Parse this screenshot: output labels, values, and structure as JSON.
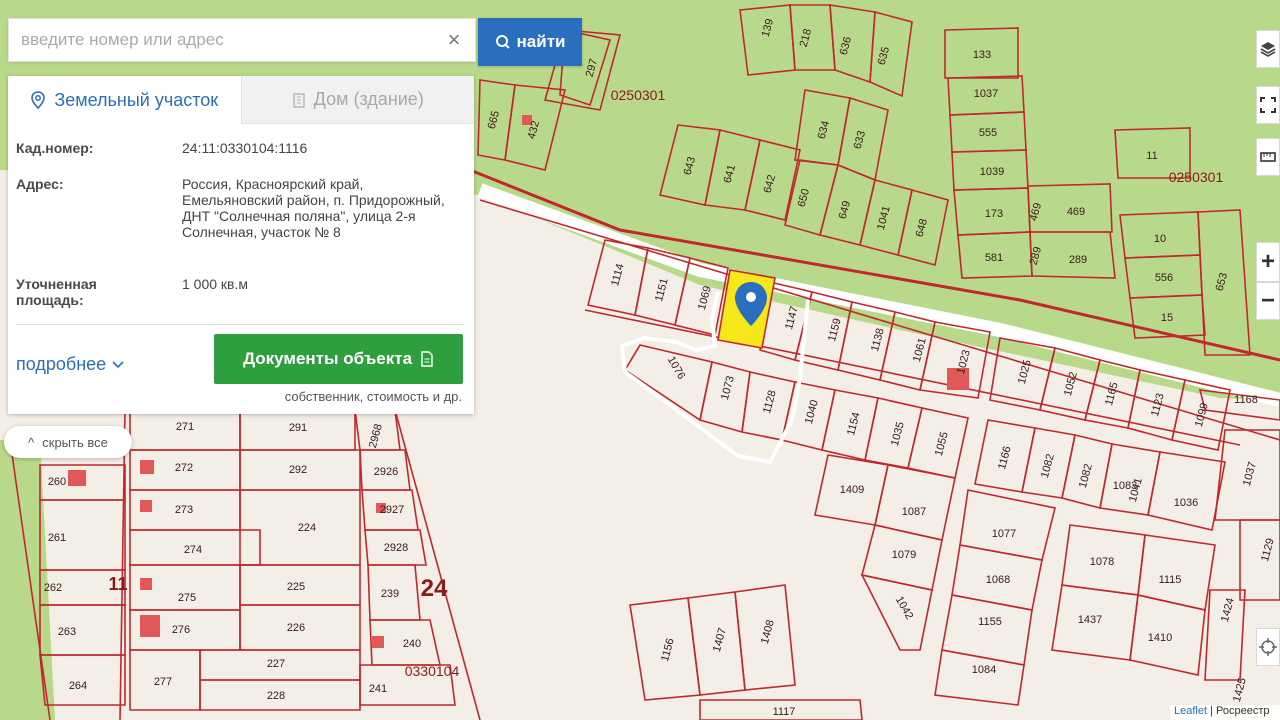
{
  "search": {
    "placeholder": "введите номер или адрес",
    "button_label": "найти"
  },
  "panel": {
    "tabs": [
      {
        "label": "Земельный участок"
      },
      {
        "label": "Дом (здание)"
      }
    ],
    "fields": [
      {
        "key": "Кад.номер:",
        "value": "24:11:0330104:1116"
      },
      {
        "key": "Адрес:",
        "value": "Россия, Красноярский край, Емельяновский район, п. Придорожный, ДНТ \"Солнечная поляна\", улица 2-я Солнечная, участок № 8"
      },
      {
        "key": "Уточненная площадь:",
        "value": "1 000 кв.м"
      }
    ],
    "more_label": "подробнее",
    "docs_button_label": "Документы объекта",
    "docs_note": "собственник, стоимость и др."
  },
  "hide_all_label": "скрыть все",
  "map": {
    "quarter_labels": [
      "0250301",
      "0250301",
      "0330104"
    ],
    "big_labels": [
      "24",
      "11"
    ],
    "parcels": [
      "139",
      "218",
      "636",
      "635",
      "133",
      "1037",
      "555",
      "1039",
      "173",
      "469",
      "469",
      "581",
      "289",
      "289",
      "297",
      "665",
      "432",
      "643",
      "641",
      "642",
      "634",
      "633",
      "650",
      "649",
      "1041",
      "648",
      "11",
      "10",
      "556",
      "15",
      "653",
      "1114",
      "1151",
      "1069",
      "1147",
      "1159",
      "1138",
      "1061",
      "1023",
      "1025",
      "1052",
      "1165",
      "1123",
      "1099",
      "1168",
      "1076",
      "1073",
      "1128",
      "1040",
      "1154",
      "1035",
      "1055",
      "1166",
      "1082",
      "1082",
      "1083",
      "1041",
      "1036",
      "1037",
      "1409",
      "1087",
      "1079",
      "1042",
      "1077",
      "1068",
      "1155",
      "1084",
      "1078",
      "1115",
      "1437",
      "1410",
      "1129",
      "1424",
      "1156",
      "1407",
      "1408",
      "1117",
      "271",
      "291",
      "2968",
      "272",
      "292",
      "2926",
      "260",
      "273",
      "2927",
      "261",
      "224",
      "274",
      "2928",
      "262",
      "275",
      "225",
      "239",
      "263",
      "276",
      "226",
      "240",
      "227",
      "264",
      "277",
      "228",
      "241",
      "1425"
    ],
    "zoom_in_label": "+",
    "zoom_out_label": "−"
  },
  "attribution": {
    "leaflet": "Leaflet",
    "rest": "| Росреестр"
  },
  "colors": {
    "boundary": "#c0282d",
    "land": "#b9d98a",
    "road": "#ffffff",
    "selected": "#f5e71a",
    "marker": "#2a6fbf",
    "primary": "#2a6fbf",
    "docs": "#2e9e3f"
  }
}
